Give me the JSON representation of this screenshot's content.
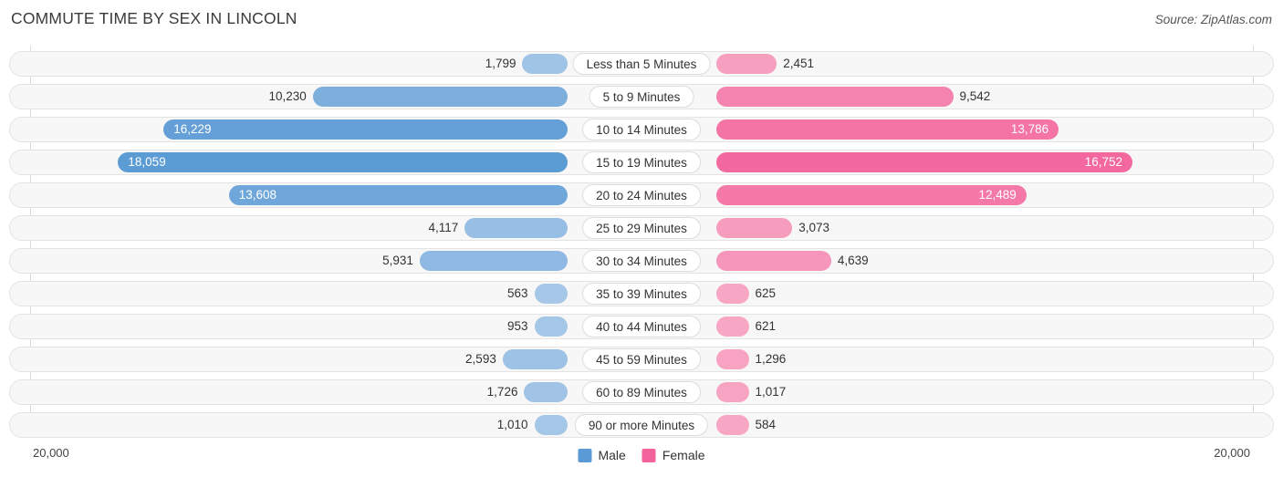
{
  "header": {
    "title": "COMMUTE TIME BY SEX IN LINCOLN",
    "source": "Source: ZipAtlas.com"
  },
  "axis": {
    "left_label": "20,000",
    "right_label": "20,000",
    "max": 20000
  },
  "legend": {
    "items": [
      {
        "label": "Male",
        "color": "#5b9bd5"
      },
      {
        "label": "Female",
        "color": "#f2629b"
      }
    ]
  },
  "colors": {
    "male_light": "#a8c8e8",
    "male_dark": "#5b9bd5",
    "female_light": "#f7a8c4",
    "female_dark": "#f2629b",
    "track": "#f7f7f7",
    "track_border": "#e3e3e3",
    "gridline": "#dcdcdc"
  },
  "chart_data": {
    "type": "bar",
    "orientation": "horizontal-diverging",
    "title": "COMMUTE TIME BY SEX IN LINCOLN",
    "source": "Source: ZipAtlas.com",
    "xlabel": "",
    "ylabel": "",
    "xlim": [
      20000,
      20000
    ],
    "grid": true,
    "legend_position": "bottom-center",
    "categories": [
      "Less than 5 Minutes",
      "5 to 9 Minutes",
      "10 to 14 Minutes",
      "15 to 19 Minutes",
      "20 to 24 Minutes",
      "25 to 29 Minutes",
      "30 to 34 Minutes",
      "35 to 39 Minutes",
      "40 to 44 Minutes",
      "45 to 59 Minutes",
      "60 to 89 Minutes",
      "90 or more Minutes"
    ],
    "series": [
      {
        "name": "Male",
        "values": [
          1799,
          10230,
          16229,
          18059,
          13608,
          4117,
          5931,
          563,
          953,
          2593,
          1726,
          1010
        ],
        "labels": [
          "1,799",
          "10,230",
          "16,229",
          "18,059",
          "13,608",
          "4,117",
          "5,931",
          "563",
          "953",
          "2,593",
          "1,726",
          "1,010"
        ]
      },
      {
        "name": "Female",
        "values": [
          2451,
          9542,
          13786,
          16752,
          12489,
          3073,
          4639,
          625,
          621,
          1296,
          1017,
          584
        ],
        "labels": [
          "2,451",
          "9,542",
          "13,786",
          "16,752",
          "12,489",
          "3,073",
          "4,639",
          "625",
          "621",
          "1,296",
          "1,017",
          "584"
        ]
      }
    ]
  }
}
